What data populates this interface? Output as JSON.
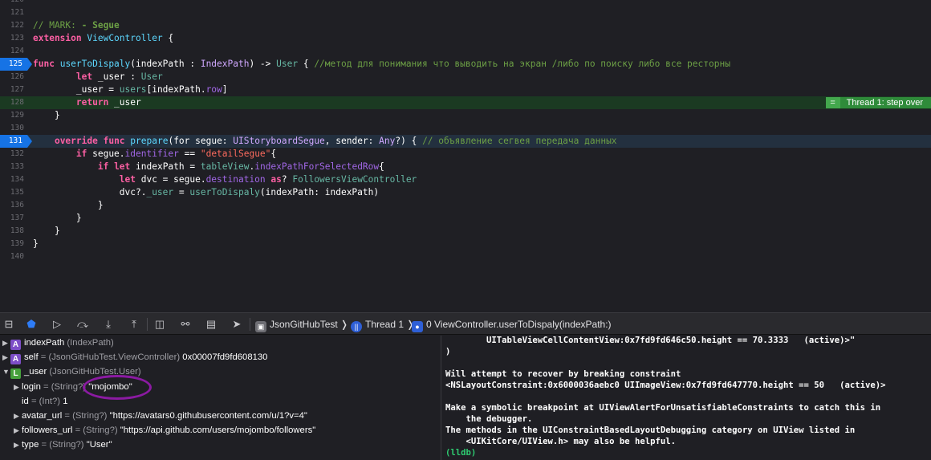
{
  "editor": {
    "lines": [
      {
        "num": "120",
        "segs": []
      },
      {
        "num": "121",
        "segs": []
      },
      {
        "num": "122",
        "segs": [
          {
            "t": "// MARK: ",
            "c": "cm"
          },
          {
            "t": "- Segue",
            "c": "cmb"
          }
        ]
      },
      {
        "num": "123",
        "segs": [
          {
            "t": "extension",
            "c": "kw"
          },
          {
            "t": " "
          },
          {
            "t": "ViewController",
            "c": "ty"
          },
          {
            "t": " {"
          }
        ]
      },
      {
        "num": "124",
        "segs": []
      },
      {
        "num": "125",
        "bp": true,
        "segs": [
          {
            "t": "func",
            "c": "kw"
          },
          {
            "t": " "
          },
          {
            "t": "userToDispaly",
            "c": "ty"
          },
          {
            "t": "(indexPath : "
          },
          {
            "t": "IndexPath",
            "c": "tp"
          },
          {
            "t": ") -> "
          },
          {
            "t": "User",
            "c": "ps"
          },
          {
            "t": " { "
          },
          {
            "t": "//метод для понимания что выводить на экран /либо по поиску либо все ресторны",
            "c": "cm"
          }
        ]
      },
      {
        "num": "126",
        "segs": [
          {
            "t": "        "
          },
          {
            "t": "let",
            "c": "kw"
          },
          {
            "t": " _user : "
          },
          {
            "t": "User",
            "c": "ps"
          }
        ]
      },
      {
        "num": "127",
        "segs": [
          {
            "t": "        _user = "
          },
          {
            "t": "users",
            "c": "fn"
          },
          {
            "t": "[indexPath."
          },
          {
            "t": "row",
            "c": "pr"
          },
          {
            "t": "]"
          }
        ]
      },
      {
        "num": "128",
        "hl": true,
        "segs": [
          {
            "t": "        "
          },
          {
            "t": "return",
            "c": "kw"
          },
          {
            "t": " _user"
          }
        ]
      },
      {
        "num": "129",
        "segs": [
          {
            "t": "    }"
          }
        ]
      },
      {
        "num": "130",
        "segs": []
      },
      {
        "num": "131",
        "bp": true,
        "cur": true,
        "segs": [
          {
            "t": "    "
          },
          {
            "t": "override",
            "c": "kw"
          },
          {
            "t": " "
          },
          {
            "t": "func",
            "c": "kw"
          },
          {
            "t": " "
          },
          {
            "t": "prepare",
            "c": "ty"
          },
          {
            "t": "(for segue: "
          },
          {
            "t": "UIStoryboardSegue",
            "c": "tp"
          },
          {
            "t": ", sender: "
          },
          {
            "t": "Any",
            "c": "tp"
          },
          {
            "t": "?) { "
          },
          {
            "t": "// объявление сегвея передача данных",
            "c": "cm"
          }
        ]
      },
      {
        "num": "132",
        "segs": [
          {
            "t": "        "
          },
          {
            "t": "if",
            "c": "kw"
          },
          {
            "t": " segue."
          },
          {
            "t": "identifier",
            "c": "pr"
          },
          {
            "t": " == "
          },
          {
            "t": "\"detailSegue\"",
            "c": "st"
          },
          {
            "t": "{"
          }
        ]
      },
      {
        "num": "133",
        "segs": [
          {
            "t": "            "
          },
          {
            "t": "if",
            "c": "kw"
          },
          {
            "t": " "
          },
          {
            "t": "let",
            "c": "kw"
          },
          {
            "t": " indexPath = "
          },
          {
            "t": "tableView",
            "c": "fn"
          },
          {
            "t": "."
          },
          {
            "t": "indexPathForSelectedRow",
            "c": "pr"
          },
          {
            "t": "{"
          }
        ]
      },
      {
        "num": "134",
        "segs": [
          {
            "t": "                "
          },
          {
            "t": "let",
            "c": "kw"
          },
          {
            "t": " dvc = segue."
          },
          {
            "t": "destination",
            "c": "pr"
          },
          {
            "t": " "
          },
          {
            "t": "as",
            "c": "kw"
          },
          {
            "t": "? "
          },
          {
            "t": "FollowersViewController",
            "c": "ps"
          }
        ]
      },
      {
        "num": "135",
        "segs": [
          {
            "t": "                dvc?."
          },
          {
            "t": "_user",
            "c": "fn"
          },
          {
            "t": " = "
          },
          {
            "t": "userToDispaly",
            "c": "fn"
          },
          {
            "t": "(indexPath: indexPath)"
          }
        ]
      },
      {
        "num": "136",
        "segs": [
          {
            "t": "            }"
          }
        ]
      },
      {
        "num": "137",
        "segs": [
          {
            "t": "        }"
          }
        ]
      },
      {
        "num": "138",
        "segs": [
          {
            "t": "    }"
          }
        ]
      },
      {
        "num": "139",
        "segs": [
          {
            "t": "}"
          }
        ]
      },
      {
        "num": "140",
        "segs": []
      }
    ],
    "thread_badge": {
      "eq": "=",
      "label": "Thread 1: step over"
    }
  },
  "debugbar": {
    "target": "JsonGitHubTest",
    "thread": "Thread 1",
    "frame": "0 ViewController.userToDispaly(indexPath:)"
  },
  "variables": [
    {
      "indent": 0,
      "tri": "▶",
      "badge": "A",
      "bclass": "a",
      "name": "indexPath",
      "type": "(IndexPath)",
      "value": ""
    },
    {
      "indent": 0,
      "tri": "▶",
      "badge": "A",
      "bclass": "a",
      "name": "self",
      "type": "= (JsonGitHubTest.ViewController)",
      "value": "0x00007fd9fd608130"
    },
    {
      "indent": 0,
      "tri": "▼",
      "badge": "L",
      "bclass": "l",
      "name": "_user",
      "type": "(JsonGitHubTest.User)",
      "value": ""
    },
    {
      "indent": 1,
      "tri": "▶",
      "badge": "",
      "name": "login",
      "type": "= (String?)",
      "value": "\"mojombo\""
    },
    {
      "indent": 1,
      "tri": "",
      "badge": "",
      "name": "id",
      "type": "= (Int?)",
      "value": "1"
    },
    {
      "indent": 1,
      "tri": "▶",
      "badge": "",
      "name": "avatar_url",
      "type": "= (String?)",
      "value": "\"https://avatars0.githubusercontent.com/u/1?v=4\""
    },
    {
      "indent": 1,
      "tri": "▶",
      "badge": "",
      "name": "followers_url",
      "type": "= (String?)",
      "value": "\"https://api.github.com/users/mojombo/followers\""
    },
    {
      "indent": 1,
      "tri": "▶",
      "badge": "",
      "name": "type",
      "type": "= (String?)",
      "value": "\"User\""
    }
  ],
  "console": {
    "lines": [
      "        UITableViewCellContentView:0x7fd9fd646c50.height == 70.3333   (active)>\"",
      ")",
      "",
      "Will attempt to recover by breaking constraint",
      "<NSLayoutConstraint:0x6000036aebc0 UIImageView:0x7fd9fd647770.height == 50   (active)>",
      "",
      "Make a symbolic breakpoint at UIViewAlertForUnsatisfiableConstraints to catch this in",
      "    the debugger.",
      "The methods in the UIConstraintBasedLayoutDebugging category on UIView listed in",
      "    <UIKitCore/UIView.h> may also be helpful."
    ],
    "prompt": "(lldb)"
  },
  "colors": {
    "keyword": "#fc5fa3",
    "type": "#5dd8ff",
    "comment": "#6c9f45",
    "string": "#fc6a5d",
    "breakpoint": "#1673e5",
    "step_badge": "#2f8b3a",
    "annotation": "#8b1aa2"
  }
}
